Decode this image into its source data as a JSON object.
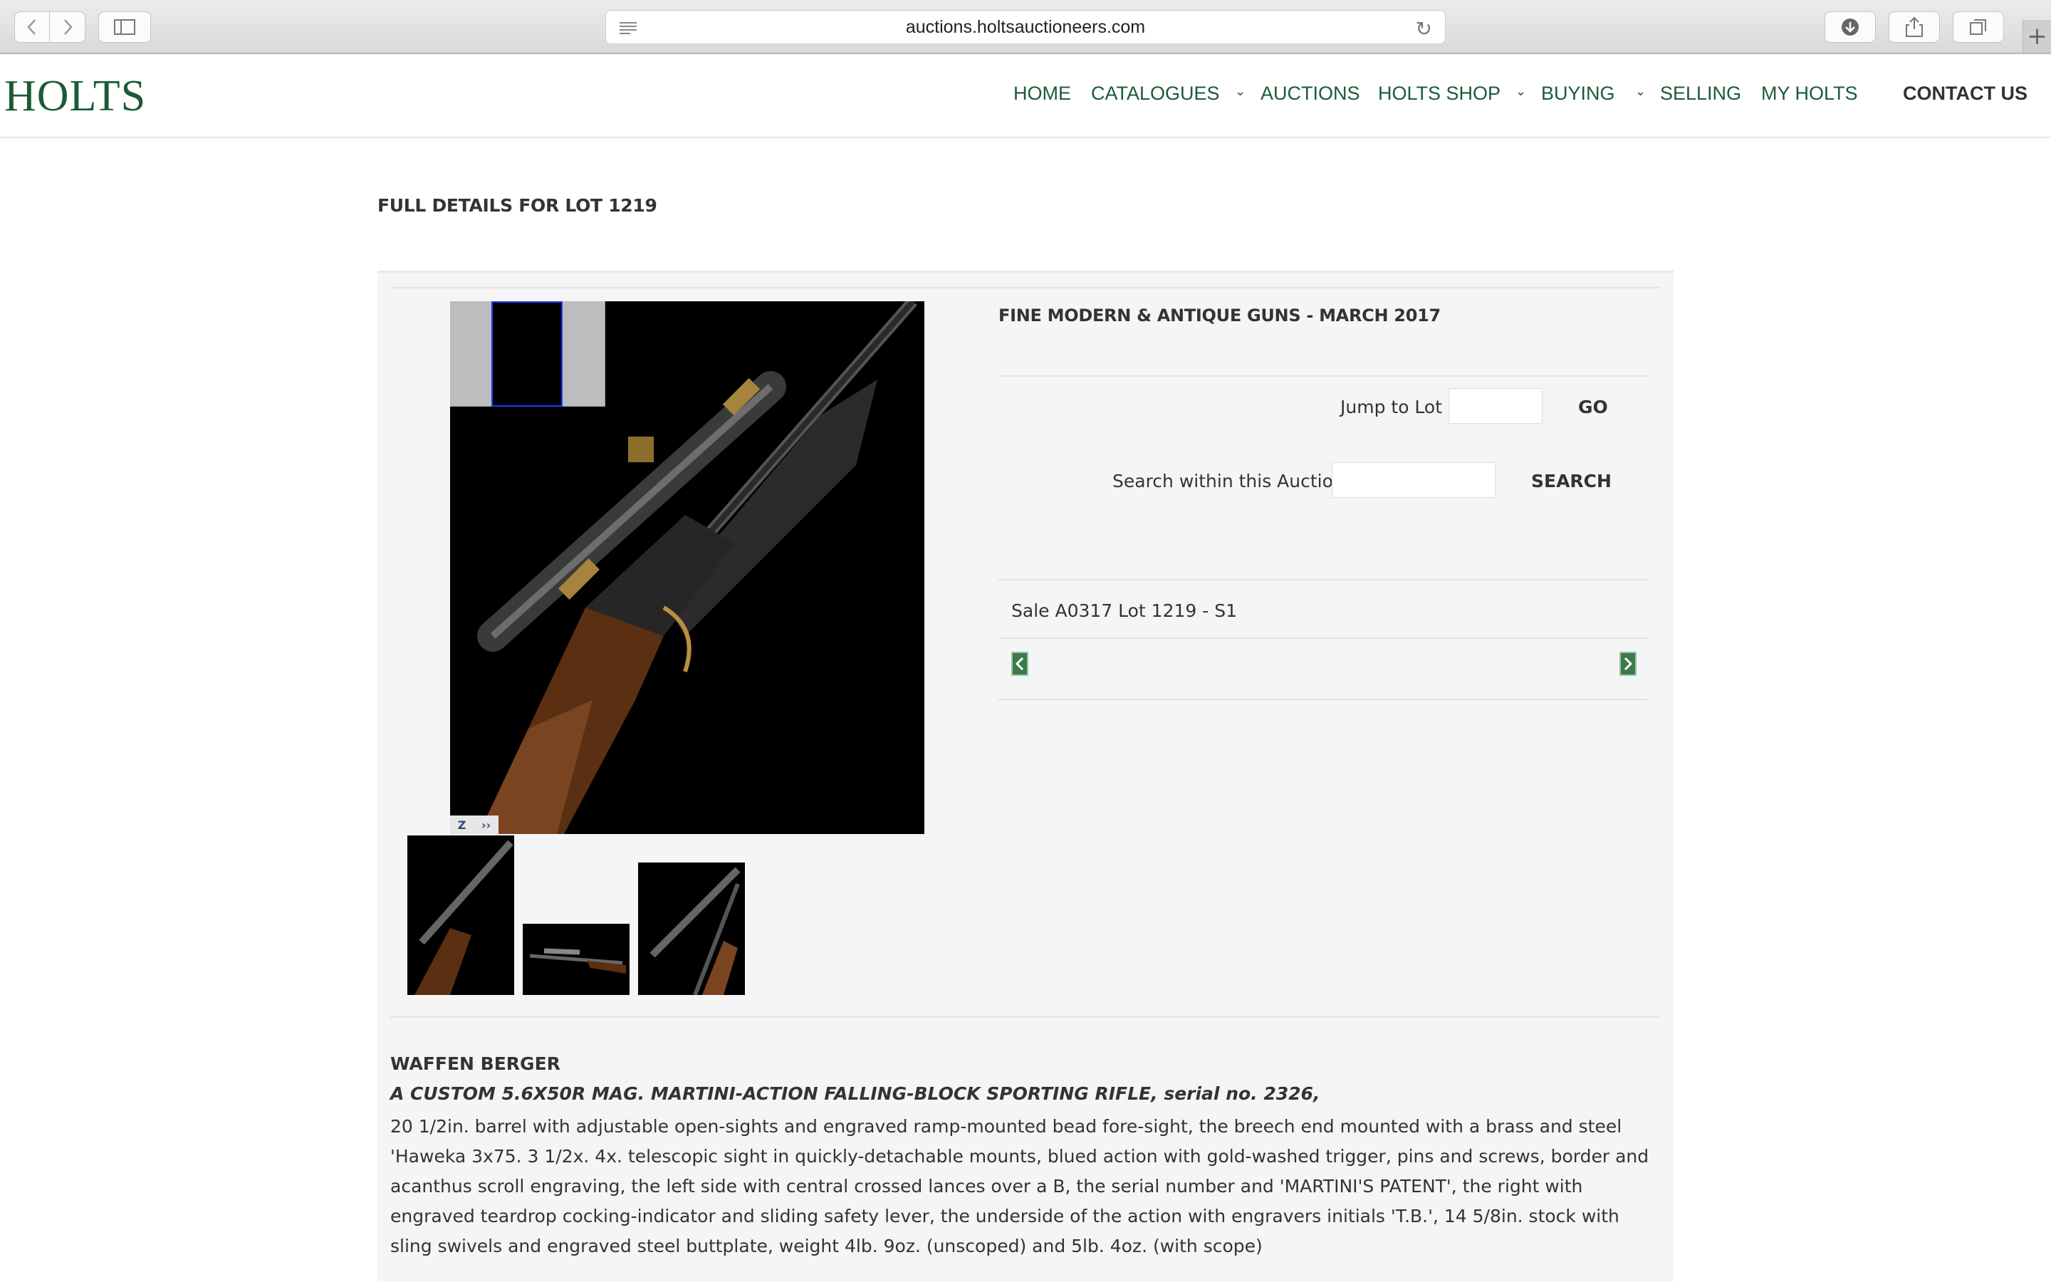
{
  "browser": {
    "url": "auctions.holtsauctioneers.com"
  },
  "header": {
    "logo": "HOLTS",
    "nav": [
      "HOME",
      "CATALOGUES",
      "AUCTIONS",
      "HOLTS SHOP",
      "BUYING",
      "SELLING",
      "MY HOLTS",
      "CONTACT US"
    ],
    "brand_color": "#1c5a37"
  },
  "page": {
    "title": "FULL DETAILS FOR LOT 1219"
  },
  "sale": {
    "title": "FINE MODERN & ANTIQUE GUNS - MARCH 2017",
    "jump_label": "Jump to Lot :",
    "go_label": "GO",
    "search_label": "Search within this Auction :",
    "search_button": "SEARCH",
    "lot_ref": "Sale A0317 Lot 1219 - S1"
  },
  "lot": {
    "brand": "WAFFEN BERGER",
    "title": "A CUSTOM 5.6X50R MAG. MARTINI-ACTION FALLING-BLOCK SPORTING RIFLE, serial no. 2326,",
    "description": "20 1/2in. barrel with adjustable open-sights and engraved ramp-mounted bead fore-sight, the breech end mounted with a brass and steel 'Haweka 3x75. 3 1/2x. 4x. telescopic sight in quickly-detachable mounts, blued action with gold-washed trigger, pins and screws, border and acanthus scroll engraving, the left side with central crossed lances over a B, the serial number and 'MARTINI'S PATENT', the right with engraved teardrop cocking-indicator and sliding safety lever, the underside of the action with engravers initials 'T.B.', 14 5/8in. stock with sling swivels and engraved steel buttplate, weight 4lb. 9oz. (unscoped) and 5lb. 4oz. (with scope)"
  },
  "zoom": {
    "zoom_glyph": "Z",
    "expand_glyph": "››"
  }
}
